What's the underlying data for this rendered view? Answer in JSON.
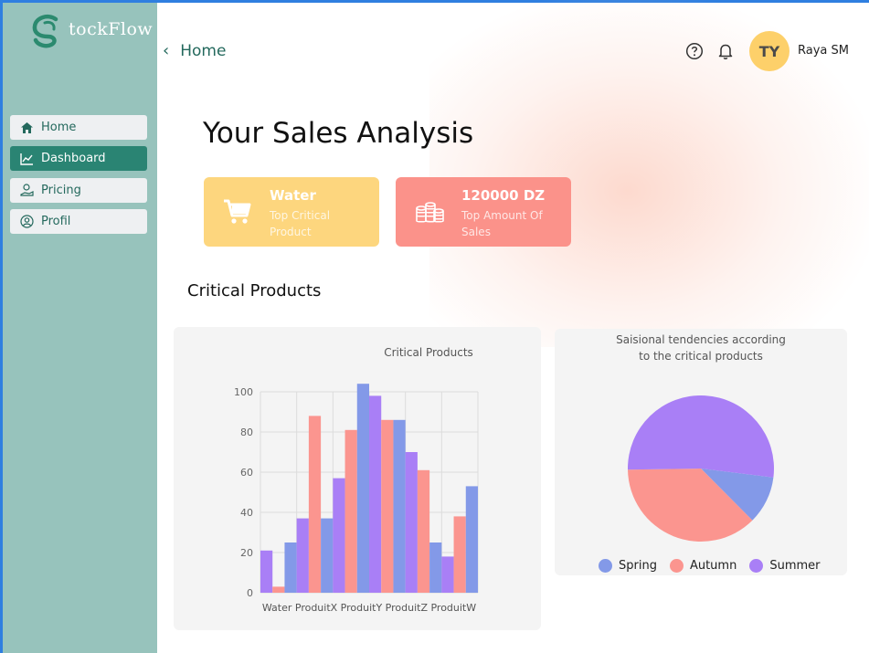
{
  "app": {
    "logo_text": "tockFlow"
  },
  "sidebar": {
    "items": [
      {
        "label": "Home",
        "icon": "home-icon"
      },
      {
        "label": "Dashboard",
        "icon": "chart-line-icon",
        "active": true
      },
      {
        "label": "Pricing",
        "icon": "money-hand-icon"
      },
      {
        "label": "Profil",
        "icon": "user-circle-icon"
      }
    ]
  },
  "header": {
    "breadcrumb": "Home",
    "user_initials": "TY",
    "user_name": "Raya SM"
  },
  "main": {
    "title": "Your Sales Analysis",
    "cards": [
      {
        "value": "Water",
        "label": "Top Critical Product",
        "color": "#fdd67e",
        "icon": "cart-icon"
      },
      {
        "value": "120000 DZ",
        "label": "Top Amount Of Sales",
        "color": "#fb928a",
        "icon": "coins-icon"
      }
    ],
    "section_title": "Critical Products"
  },
  "colors": {
    "spring": "#8399e8",
    "autumn": "#fb958f",
    "summer": "#a97ff6",
    "sidebar": "#97c3bc",
    "accent": "#2a8473"
  },
  "chart_data": [
    {
      "type": "bar",
      "title": "Critical Products",
      "categories": [
        "Water",
        "ProduitX",
        "ProduitY",
        "ProduitZ",
        "ProduitW"
      ],
      "series": [
        {
          "name": "Spring",
          "values": [
            25,
            37,
            104,
            86,
            25,
            53
          ]
        },
        {
          "name": "Autumn",
          "values": [
            3,
            88,
            81,
            86,
            61,
            38
          ]
        },
        {
          "name": "Summer",
          "values": [
            21,
            37,
            57,
            98,
            70,
            18
          ]
        }
      ],
      "ylim": [
        0,
        100
      ],
      "yticks": [
        0,
        20,
        40,
        60,
        80,
        100
      ],
      "grid": true
    },
    {
      "type": "pie",
      "title": "Saisional tendencies according to the critical products",
      "labels": [
        "Spring",
        "Autumn",
        "Summer"
      ],
      "values": [
        10.6,
        37.2,
        52.2
      ],
      "legend": "bottom"
    }
  ]
}
